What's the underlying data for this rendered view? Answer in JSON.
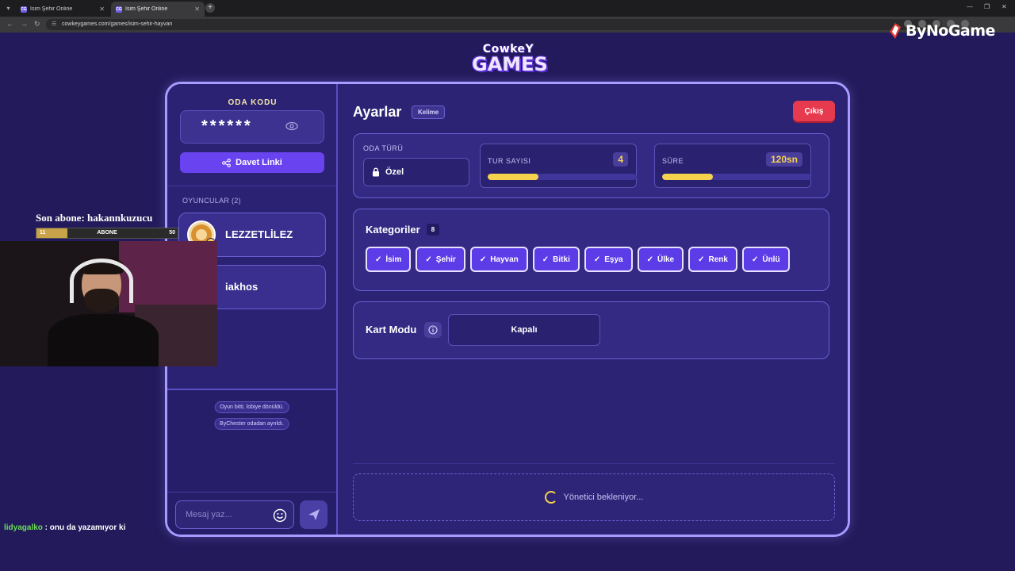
{
  "browser": {
    "tabs": [
      {
        "title": "İsim Şehir Online",
        "active": false
      },
      {
        "title": "İsim Şehir Online",
        "active": true
      }
    ],
    "favicon_text": "CG",
    "url": "cowkeygames.com/games/isim-sehir-hayvan"
  },
  "watermark": {
    "brand": "ByNoGame"
  },
  "logo": {
    "line1": "CowkeY",
    "line2": "GAMES"
  },
  "room": {
    "code_label": "ODA KODU",
    "code_masked": "******",
    "invite_label": "Davet Linki",
    "players_label": "OYUNCULAR (2)",
    "players": [
      {
        "name": "LEZZETLİLEZ",
        "has_avatar": true
      },
      {
        "name": "iakhos",
        "has_avatar": false
      }
    ],
    "log": [
      "Oyun bitti, lobiye dönüldü.",
      "ByChester odadan ayrıldı."
    ],
    "chat_placeholder": "Mesaj yaz..."
  },
  "settings": {
    "title": "Ayarlar",
    "mode_badge": "Kelime",
    "exit_label": "Çıkış",
    "room_type_label": "ODA TÜRÜ",
    "room_type_value": "Özel",
    "rounds_label": "TUR SAYISI",
    "rounds_value": "4",
    "rounds_fill_pct": 34,
    "time_label": "SÜRE",
    "time_value": "120sn",
    "time_fill_pct": 34,
    "categories_title": "Kategoriler",
    "categories_count": "8",
    "categories": [
      "İsim",
      "Şehir",
      "Hayvan",
      "Bitki",
      "Eşya",
      "Ülke",
      "Renk",
      "Ünlü"
    ],
    "card_mode_label": "Kart Modu",
    "card_mode_value": "Kapalı",
    "waiting_text": "Yönetici bekleniyor..."
  },
  "stream_overlay": {
    "last_sub": "Son abone: hakannkuzucu",
    "bar_left": "11",
    "bar_center": "ABONE",
    "bar_right": "50",
    "bar_fill_fraction": 0.22,
    "chat": {
      "user": "lidyagalko",
      "message": " : onu da yazamıyor ki"
    }
  },
  "colors": {
    "page_bg": "#221a5a",
    "card_border": "#a79bff",
    "accent": "#5b3ce6",
    "exit": "#e63b4f",
    "highlight": "#f6d34c"
  }
}
